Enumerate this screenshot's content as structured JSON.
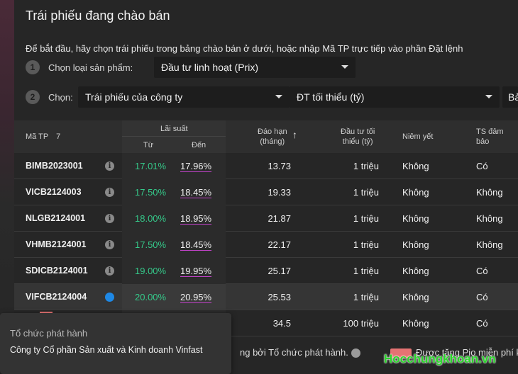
{
  "title": "Trái phiếu đang chào bán",
  "instruction": "Để bắt đầu, hãy chọn trái phiếu trong bảng chào bán ở dưới, hoặc nhập Mã TP trực tiếp vào phần Đặt lệnh",
  "step1": {
    "number": "1",
    "label": "Chọn loại sản phẩm:",
    "value": "Đầu tư linh hoạt (Prix)"
  },
  "step2": {
    "number": "2",
    "label": "Chọn:",
    "filter1": "Trái phiếu của công ty",
    "filter2": "ĐT tối thiểu (tỷ)",
    "filter3": "Bả"
  },
  "table": {
    "headers": {
      "code": "Mã TP",
      "count": "7",
      "rate_group": "Lãi suất",
      "rate_from": "Từ",
      "rate_to": "Đến",
      "term_line1": "Đáo hạn",
      "term_line2": "(tháng)",
      "min_line1": "Đầu tư tối",
      "min_line2": "thiểu (tỷ)",
      "listed": "Niêm yết",
      "collat_line1": "TS đảm",
      "collat_line2": "bảo"
    },
    "rows": [
      {
        "code": "BIMB2023001",
        "from": "17.01%",
        "to": "17.96%",
        "term": "13.73",
        "min": "1 triệu",
        "listed": "Không",
        "collat": "Có"
      },
      {
        "code": "VICB2124003",
        "from": "17.50%",
        "to": "18.45%",
        "term": "19.33",
        "min": "1 triệu",
        "listed": "Không",
        "collat": "Không"
      },
      {
        "code": "NLGB2124001",
        "from": "18.00%",
        "to": "18.95%",
        "term": "21.87",
        "min": "1 triệu",
        "listed": "Không",
        "collat": "Không"
      },
      {
        "code": "VHMB2124001",
        "from": "17.50%",
        "to": "18.45%",
        "term": "22.17",
        "min": "1 triệu",
        "listed": "Không",
        "collat": "Không"
      },
      {
        "code": "SDICB2124001",
        "from": "19.00%",
        "to": "19.95%",
        "term": "25.17",
        "min": "1 triệu",
        "listed": "Không",
        "collat": "Có"
      },
      {
        "code": "VIFCB2124004",
        "from": "20.00%",
        "to": "20.95%",
        "term": "25.53",
        "min": "1 triệu",
        "listed": "Không",
        "collat": "Có"
      },
      {
        "code": "",
        "from": "",
        "to": "",
        "term": "34.5",
        "min": "100 triệu",
        "listed": "Không",
        "collat": "Có"
      }
    ]
  },
  "tooltip": {
    "label": "Tổ chức phát hành",
    "value": "Công ty Cổ phần Sản xuất và Kinh doanh Vinfast"
  },
  "footnote": "ng bởi Tổ chức phát hành.",
  "footnote2": "Được tặng Pio miễn phí khi",
  "watermark": "Hocchungkhoan.vn",
  "colors": {
    "rate_from": "#35c98a",
    "rate_to_underline": "#c042c8",
    "active_info": "#1e88e5",
    "badge": "#e57373"
  }
}
